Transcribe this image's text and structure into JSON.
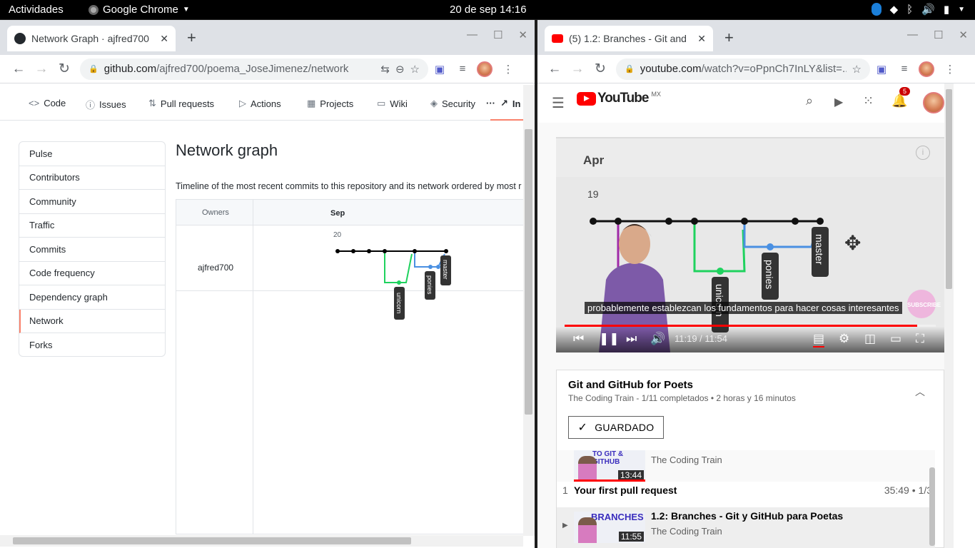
{
  "topbar": {
    "activities": "Actividades",
    "app": "Google Chrome",
    "clock": "20 de sep  14:16"
  },
  "left": {
    "tab_title": "Network Graph · ajfred700",
    "url_host": "github.com",
    "url_path": "/ajfred700/poema_JoseJimenez/network",
    "nav": [
      "Code",
      "Issues",
      "Pull requests",
      "Actions",
      "Projects",
      "Wiki",
      "Security",
      "In"
    ],
    "menu": [
      "Pulse",
      "Contributors",
      "Community",
      "Traffic",
      "Commits",
      "Code frequency",
      "Dependency graph",
      "Network",
      "Forks"
    ],
    "heading": "Network graph",
    "description": "Timeline of the most recent commits to this repository and its network ordered by most r",
    "owners_label": "Owners",
    "month": "Sep",
    "day": "20",
    "owner": "ajfred700",
    "branches": [
      "unicorn",
      "ponies",
      "master"
    ]
  },
  "right": {
    "tab_title": "(5) 1.2: Branches - Git and",
    "url_host": "youtube.com",
    "url_path": "/watch?v=oPpnCh7InLY&list=...",
    "logo": "YouTube",
    "country": "MX",
    "notif_count": "5",
    "video": {
      "month": "Apr",
      "day": "19",
      "branches": [
        "unicorn",
        "ponies",
        "master"
      ],
      "subscribe": "SUBSCRIBE",
      "subtitle": "probablemente establezcan los fundamentos para hacer cosas interesantes",
      "time": "11:19 / 11:54",
      "progress": 0.95
    },
    "playlist": {
      "title": "Git and GitHub for Poets",
      "meta": "The Coding Train - 1/11 completados • 2 horas y 16 minutos",
      "saved": "GUARDADO",
      "items": [
        {
          "channel": "The Coding Train",
          "duration": "13:44",
          "thumb_text": "TO GIT & GITHUB"
        },
        {
          "index": "1",
          "title": "Your first pull request",
          "right": "35:49 • 1/3"
        },
        {
          "title": "1.2: Branches - Git y GitHub para Poetas",
          "channel": "The Coding Train",
          "duration": "11:55",
          "thumb_text": "BRANCHES"
        }
      ]
    }
  }
}
